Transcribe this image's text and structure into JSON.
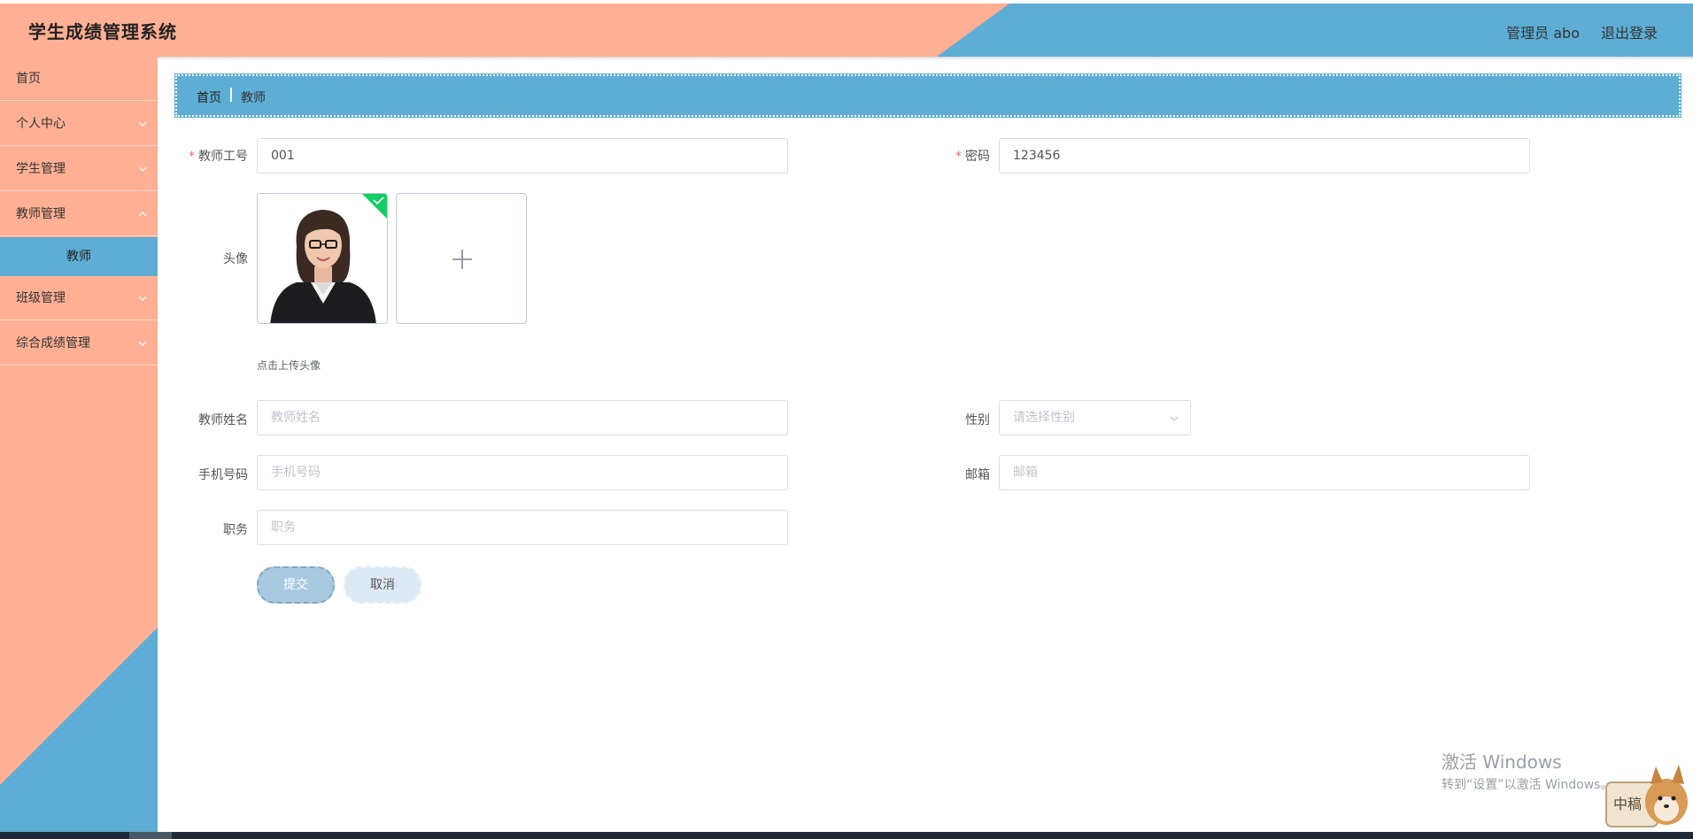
{
  "header": {
    "title": "学生成绩管理系统",
    "user": "管理员 abo",
    "logout": "退出登录"
  },
  "sidebar": {
    "items": [
      {
        "label": "首页"
      },
      {
        "label": "个人中心"
      },
      {
        "label": "学生管理"
      },
      {
        "label": "教师管理"
      },
      {
        "label": "班级管理"
      },
      {
        "label": "综合成绩管理"
      }
    ],
    "active_sub": "教师"
  },
  "breadcrumb": {
    "home": "首页",
    "current": "教师"
  },
  "form": {
    "teacher_id": {
      "label": "教师工号",
      "value": "001"
    },
    "password": {
      "label": "密码",
      "value": "123456"
    },
    "avatar": {
      "label": "头像",
      "tip": "点击上传头像"
    },
    "teacher_name": {
      "label": "教师姓名",
      "placeholder": "教师姓名"
    },
    "gender": {
      "label": "性别",
      "placeholder": "请选择性别"
    },
    "phone": {
      "label": "手机号码",
      "placeholder": "手机号码"
    },
    "email": {
      "label": "邮箱",
      "placeholder": "邮箱"
    },
    "position": {
      "label": "职务",
      "placeholder": "职务"
    },
    "submit_label": "提交",
    "cancel_label": "取消"
  },
  "watermark": {
    "title": "激活 Windows",
    "subtitle": "转到“设置”以激活 Windows。"
  },
  "mascot_badge": "中稿",
  "colors": {
    "salmon": "#ffb094",
    "blue": "#5eadd4",
    "success": "#13ce66"
  }
}
